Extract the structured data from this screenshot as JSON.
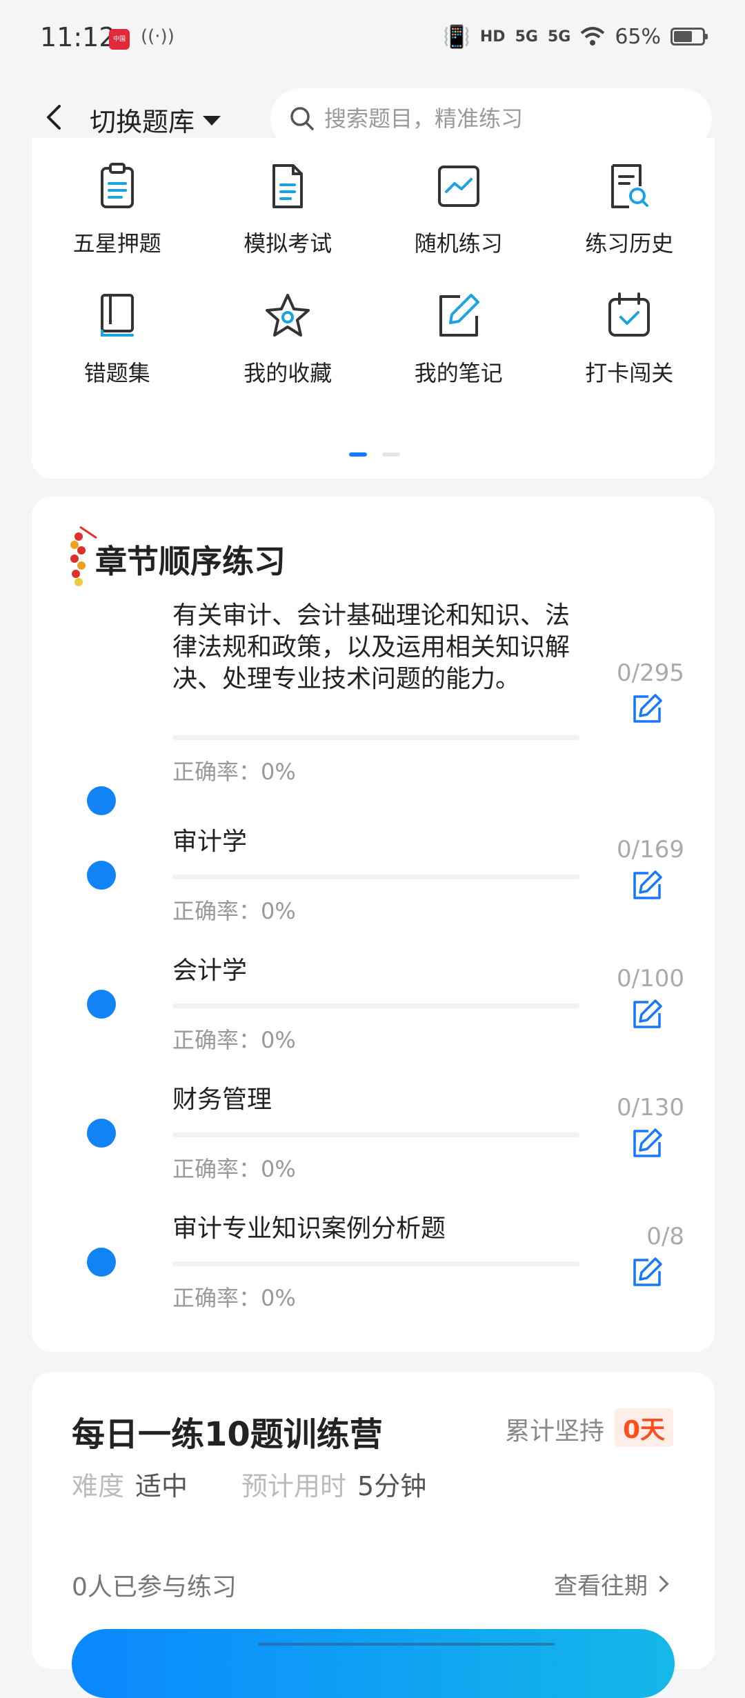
{
  "status_bar": {
    "time": "11:12",
    "app_icon_text": "中国",
    "nfc": "((·))",
    "hd": "HD",
    "net1": "5G",
    "net2": "5G",
    "battery": "65%"
  },
  "nav": {
    "bank_switch_label": "切换题库",
    "search_placeholder": "搜索题目，精准练习"
  },
  "features": [
    {
      "label": "五星押题",
      "icon": "clipboard-icon"
    },
    {
      "label": "模拟考试",
      "icon": "document-icon"
    },
    {
      "label": "随机练习",
      "icon": "line-chart-icon"
    },
    {
      "label": "练习历史",
      "icon": "history-search-icon"
    },
    {
      "label": "错题集",
      "icon": "book-icon"
    },
    {
      "label": "我的收藏",
      "icon": "star-icon"
    },
    {
      "label": "我的笔记",
      "icon": "note-edit-icon"
    },
    {
      "label": "打卡闯关",
      "icon": "calendar-check-icon"
    }
  ],
  "feature_pager": {
    "pages": 2,
    "active": 0
  },
  "chapter_section": {
    "title": "章节顺序练习",
    "items": [
      {
        "name": "有关审计、会计基础理论和知识、法律法规和政策，以及运用相关知识解决、处理专业技术问题的能力。",
        "rate_label": "正确率：0%",
        "count": "0/295",
        "progress": 0
      },
      {
        "name": "审计学",
        "rate_label": "正确率：0%",
        "count": "0/169",
        "progress": 0
      },
      {
        "name": "会计学",
        "rate_label": "正确率：0%",
        "count": "0/100",
        "progress": 0
      },
      {
        "name": "财务管理",
        "rate_label": "正确率：0%",
        "count": "0/130",
        "progress": 0
      },
      {
        "name": "审计专业知识案例分析题",
        "rate_label": "正确率：0%",
        "count": "0/8",
        "progress": 0
      }
    ]
  },
  "daily": {
    "title": "每日一练10题训练营",
    "streak_label": "累计坚持",
    "streak_value": "0天",
    "difficulty_key": "难度",
    "difficulty_value": "适中",
    "time_key": "预计用时",
    "time_value": "5分钟",
    "participants": "0人已参与练习",
    "history_link": "查看往期"
  },
  "colors": {
    "accent": "#1677ff",
    "dot": "#1183f5",
    "streak": "#ff4d1f"
  }
}
